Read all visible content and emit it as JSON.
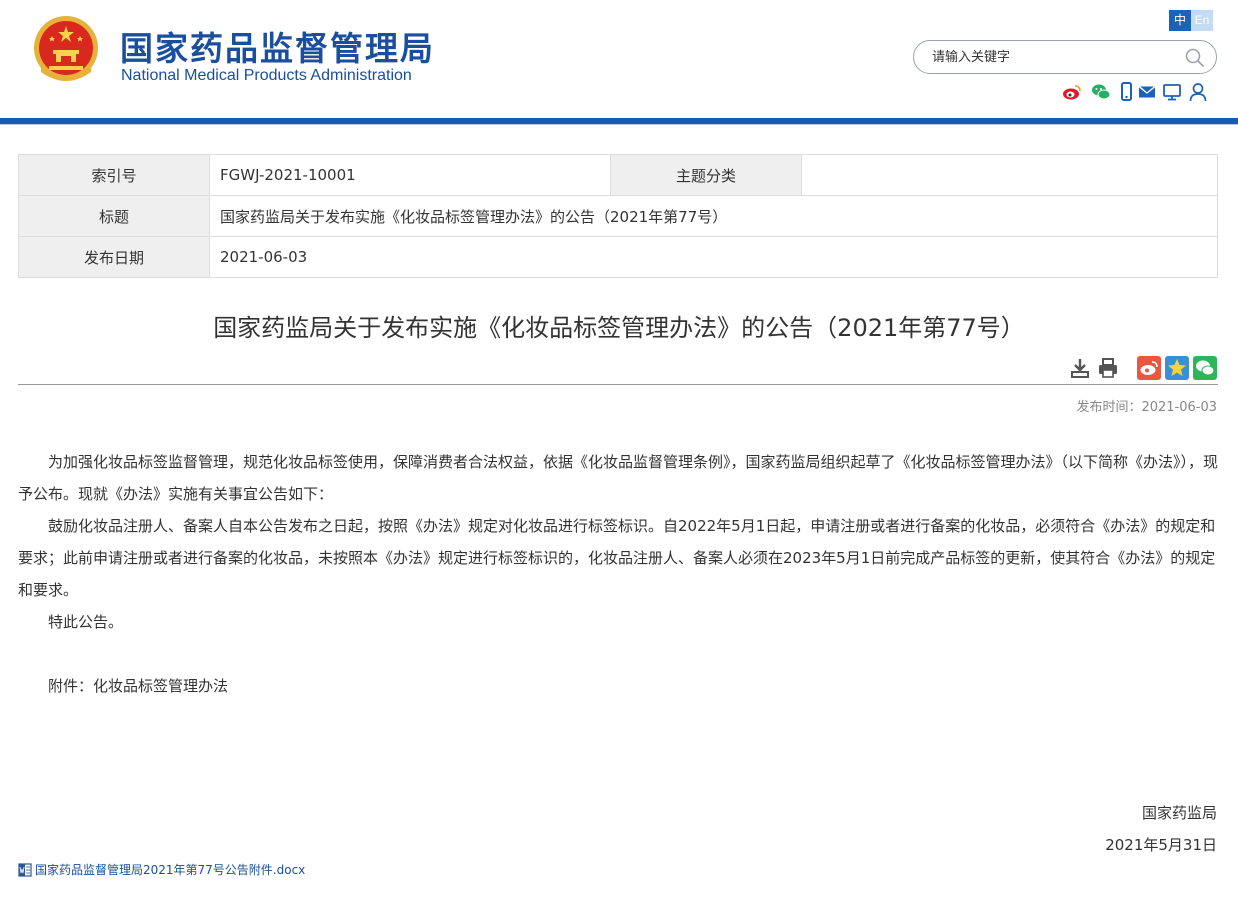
{
  "header": {
    "title_cn": "国家药品监督管理局",
    "title_en": "National Medical Products Administration",
    "lang_cn": "中",
    "lang_en": "En",
    "search_placeholder": "请输入关键字",
    "social_icons": [
      "weibo-icon",
      "wechat-icon",
      "mobile-icon",
      "mail-icon",
      "monitor-icon",
      "user-icon"
    ]
  },
  "meta": {
    "index_label": "索引号",
    "index_value": "FGWJ-2021-10001",
    "topic_label": "主题分类",
    "topic_value": "",
    "title_label": "标题",
    "title_value": "国家药监局关于发布实施《化妆品标签管理办法》的公告（2021年第77号）",
    "date_label": "发布日期",
    "date_value": "2021-06-03"
  },
  "article": {
    "title": "国家药监局关于发布实施《化妆品标签管理办法》的公告（2021年第77号）",
    "publish_time": "发布时间：2021-06-03",
    "paragraphs": [
      "为加强化妆品标签监督管理，规范化妆品标签使用，保障消费者合法权益，依据《化妆品监督管理条例》，国家药监局组织起草了《化妆品标签管理办法》（以下简称《办法》），现予公布。现就《办法》实施有关事宜公告如下：",
      "鼓励化妆品注册人、备案人自本公告发布之日起，按照《办法》规定对化妆品进行标签标识。自2022年5月1日起，申请注册或者进行备案的化妆品，必须符合《办法》的规定和要求；此前申请注册或者进行备案的化妆品，未按照本《办法》规定进行标签标识的，化妆品注册人、备案人必须在2023年5月1日前完成产品标签的更新，使其符合《办法》的规定和要求。",
      "特此公告。"
    ],
    "attachment_line": "附件：化妆品标签管理办法",
    "signer": "国家药监局",
    "sign_date": "2021年5月31日",
    "attachment_file": "国家药品监督管理局2021年第77号公告附件.docx"
  },
  "colors": {
    "brand_blue": "#1a4e9e",
    "bar_blue": "#1e59ad"
  }
}
